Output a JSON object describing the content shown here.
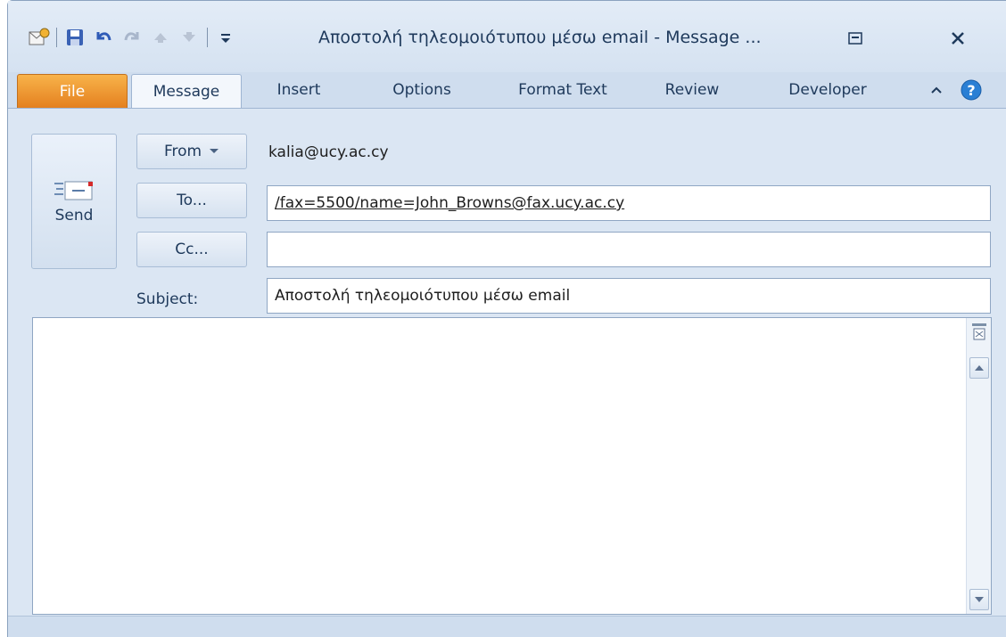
{
  "window": {
    "title": "Αποστολή τηλεομοιότυπου μέσω email  -  Message ..."
  },
  "quick_access": {
    "icons": [
      "outlook-icon",
      "save-icon",
      "undo-icon",
      "redo-icon",
      "previous-icon",
      "next-icon",
      "customize-qat-icon"
    ]
  },
  "tabs": [
    {
      "label": "File"
    },
    {
      "label": "Message"
    },
    {
      "label": "Insert"
    },
    {
      "label": "Options"
    },
    {
      "label": "Format Text"
    },
    {
      "label": "Review"
    },
    {
      "label": "Developer"
    }
  ],
  "compose": {
    "send_label": "Send",
    "from_label": "From",
    "from_value": "kalia@ucy.ac.cy",
    "to_label": "To...",
    "to_value": "/fax=5500/name=John_Browns@fax.ucy.ac.cy",
    "cc_label": "Cc...",
    "cc_value": "",
    "subject_label": "Subject:",
    "subject_value": "Αποστολή τηλεομοιότυπου μέσω email",
    "body_value": ""
  },
  "colors": {
    "file_tab": "#e4801f",
    "ribbon_bg": "#cfddee",
    "help_icon": "#2a7fd4"
  }
}
